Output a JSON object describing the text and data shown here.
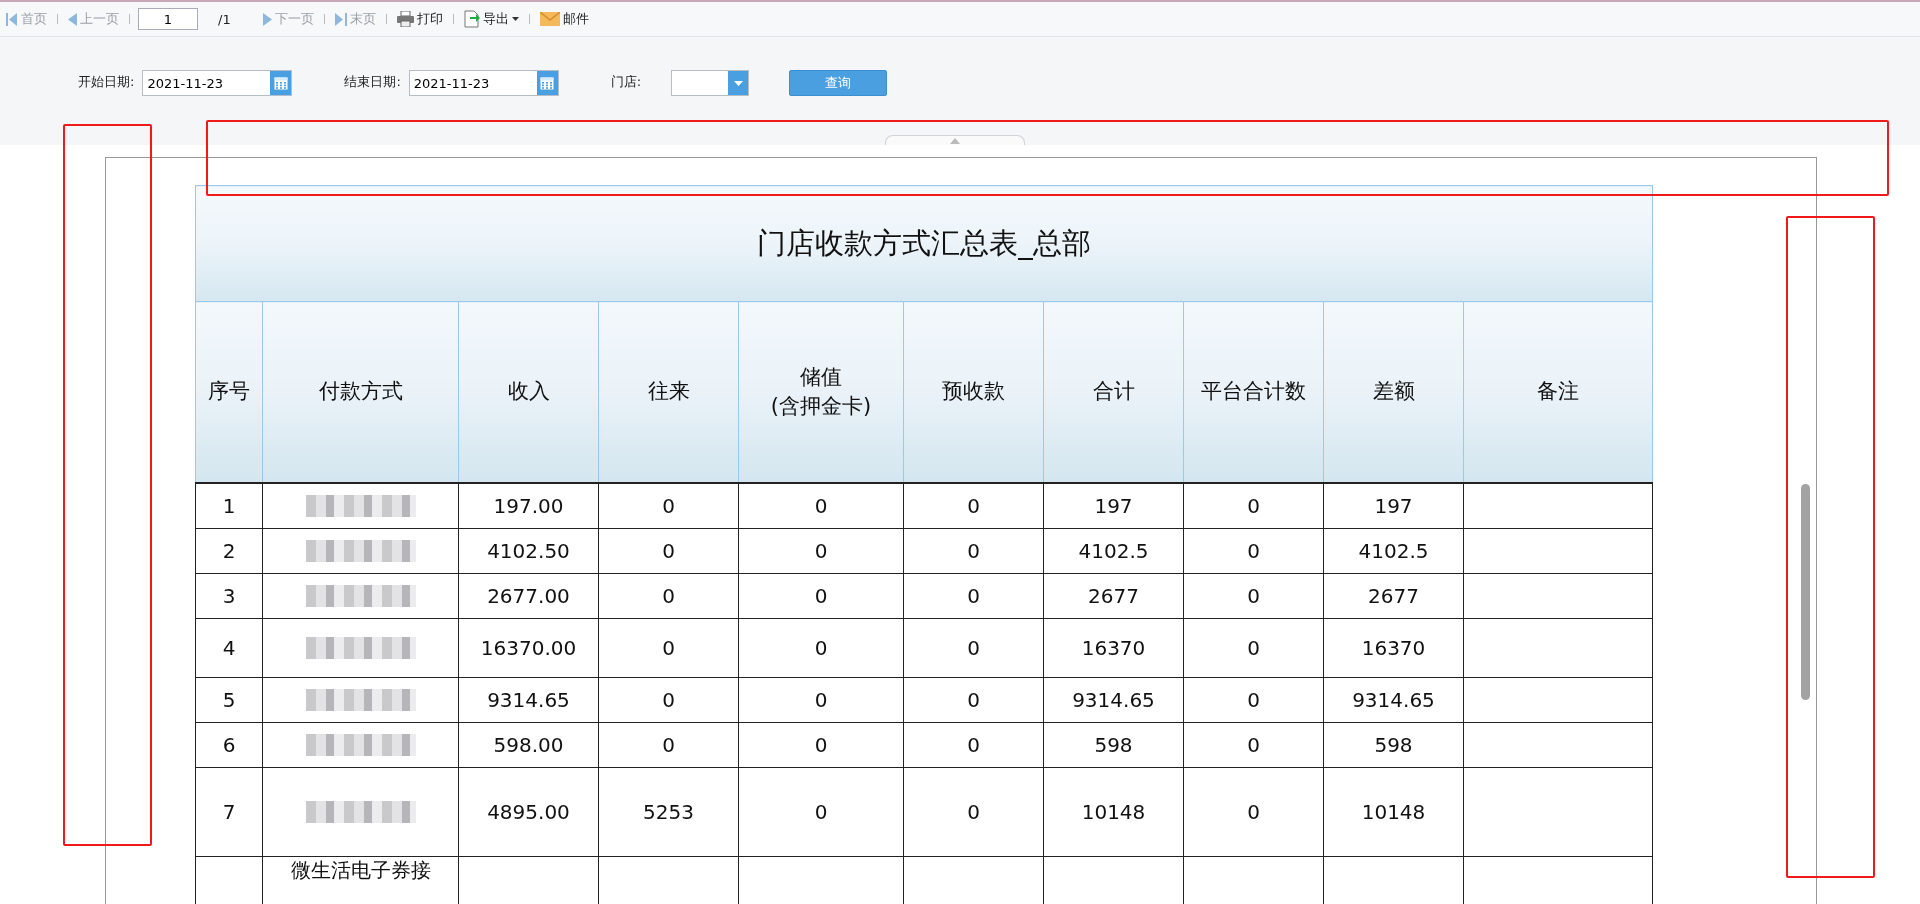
{
  "toolbar": {
    "items": [
      {
        "kind": "first",
        "label": "首页",
        "disabled": true
      },
      {
        "kind": "prev",
        "label": "上一页",
        "disabled": true
      },
      {
        "kind": "page",
        "value": "1",
        "total": "/1"
      },
      {
        "kind": "next",
        "label": "下一页",
        "disabled": true
      },
      {
        "kind": "last",
        "label": "末页",
        "disabled": true
      },
      {
        "kind": "print",
        "label": "打印",
        "disabled": false
      },
      {
        "kind": "export",
        "label": "导出",
        "disabled": false
      },
      {
        "kind": "mail",
        "label": "邮件",
        "disabled": false
      }
    ]
  },
  "filters": [
    {
      "kind": "date",
      "label": "开始日期:",
      "value": "2021-11-23"
    },
    {
      "kind": "date",
      "label": "结束日期:",
      "value": "2021-11-23"
    },
    {
      "kind": "select",
      "label": "门店:"
    }
  ],
  "query_button": "查询",
  "report": {
    "title": "门店收款方式汇总表_总部",
    "columns": [
      "序号",
      "付款方式",
      "收入",
      "往来",
      "储值\n(含押金卡)",
      "预收款",
      "合计",
      "平台合计数",
      "差额",
      "备注"
    ],
    "rows": [
      {
        "kind": "redacted",
        "cells": [
          "1",
          "",
          "197.00",
          "0",
          "0",
          "0",
          "197",
          "0",
          "197",
          ""
        ]
      },
      {
        "kind": "redacted",
        "cells": [
          "2",
          "",
          "4102.50",
          "0",
          "0",
          "0",
          "4102.5",
          "0",
          "4102.5",
          ""
        ]
      },
      {
        "kind": "redacted",
        "cells": [
          "3",
          "",
          "2677.00",
          "0",
          "0",
          "0",
          "2677",
          "0",
          "2677",
          ""
        ]
      },
      {
        "kind": "redacted",
        "cells": [
          "4",
          "",
          "16370.00",
          "0",
          "0",
          "0",
          "16370",
          "0",
          "16370",
          ""
        ]
      },
      {
        "kind": "redacted",
        "cells": [
          "5",
          "",
          "9314.65",
          "0",
          "0",
          "0",
          "9314.65",
          "0",
          "9314.65",
          ""
        ]
      },
      {
        "kind": "redacted",
        "cells": [
          "6",
          "",
          "598.00",
          "0",
          "0",
          "0",
          "598",
          "0",
          "598",
          ""
        ]
      },
      {
        "kind": "redacted",
        "cells": [
          "7",
          "",
          "4895.00",
          "5253",
          "0",
          "0",
          "10148",
          "0",
          "10148",
          ""
        ]
      },
      {
        "kind": "text",
        "cells": [
          "",
          "微生活电子券接",
          "",
          "",
          "",
          "",
          "",
          "",
          "",
          ""
        ]
      }
    ]
  }
}
